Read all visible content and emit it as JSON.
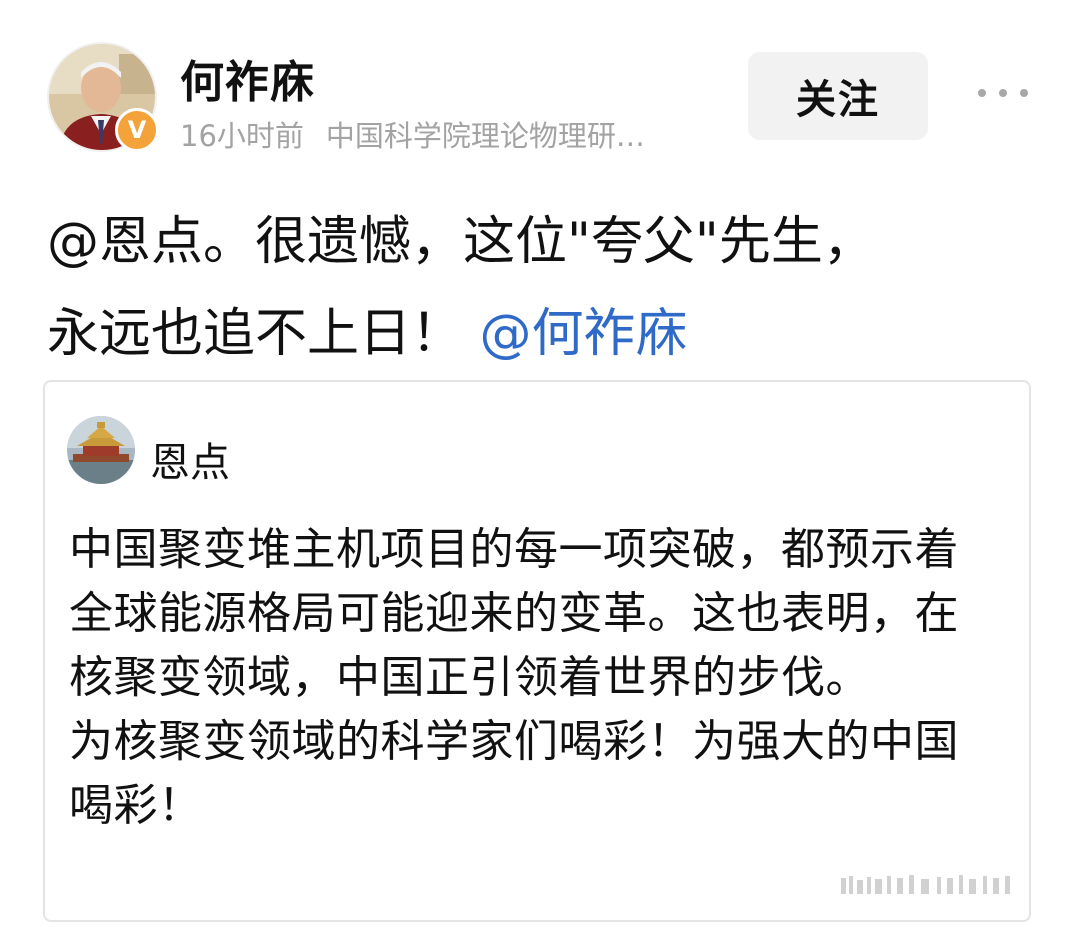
{
  "author": {
    "name": "何祚庥",
    "verified_badge": "V",
    "time": "16小时前",
    "description": "中国科学院理论物理研…"
  },
  "actions": {
    "follow_label": "关注",
    "more_icon": "more-horizontal-icon"
  },
  "post": {
    "text_line1": "@恩点。很遗憾，这位\"夸父\"先生，",
    "text_line2": "永远也追不上日！",
    "mention": "@何祚庥"
  },
  "quoted": {
    "author": "恩点",
    "text": "中国聚变堆主机项目的每一项突破，都预示着全球能源格局可能迎来的变革。这也表明，在核聚变领域，中国正引领着世界的步伐。\n为核聚变领域的科学家们喝彩！为强大的中国喝彩！"
  },
  "colors": {
    "mention": "#2f6ac8",
    "badge": "#f4a23a",
    "meta_text": "#a3a3a3",
    "follow_bg": "#f2f2f2"
  }
}
